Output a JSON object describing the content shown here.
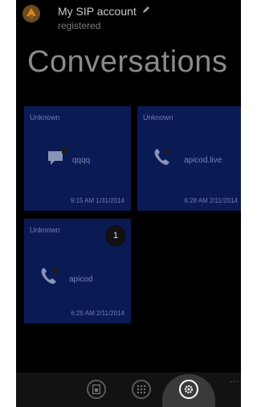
{
  "account": {
    "name": "My SIP account",
    "status": "registered",
    "icon": "sip-account-icon",
    "edit_icon": "pencil-icon"
  },
  "page": {
    "title": "Conversations"
  },
  "tiles": [
    {
      "contact": "Unknown",
      "label": "qqqq",
      "time": "9:15 AM 1/31/2014",
      "icon": "message-icon"
    },
    {
      "contact": "Unknown",
      "label": "apicod.live",
      "time": "6:28 AM 2/11/2014",
      "icon": "phone-icon"
    },
    {
      "contact": "Unknown",
      "label": "apicod",
      "time": "6:25 AM 2/11/2014",
      "icon": "phone-icon",
      "badge": "1"
    }
  ],
  "appbar": {
    "buttons": [
      {
        "icon": "contacts-icon"
      },
      {
        "icon": "dialpad-icon"
      },
      {
        "icon": "settings-icon",
        "active": true
      }
    ],
    "more": "..."
  },
  "colors": {
    "background": "#000000",
    "tile": "#0a1a55",
    "title": "#8a8a8a"
  }
}
